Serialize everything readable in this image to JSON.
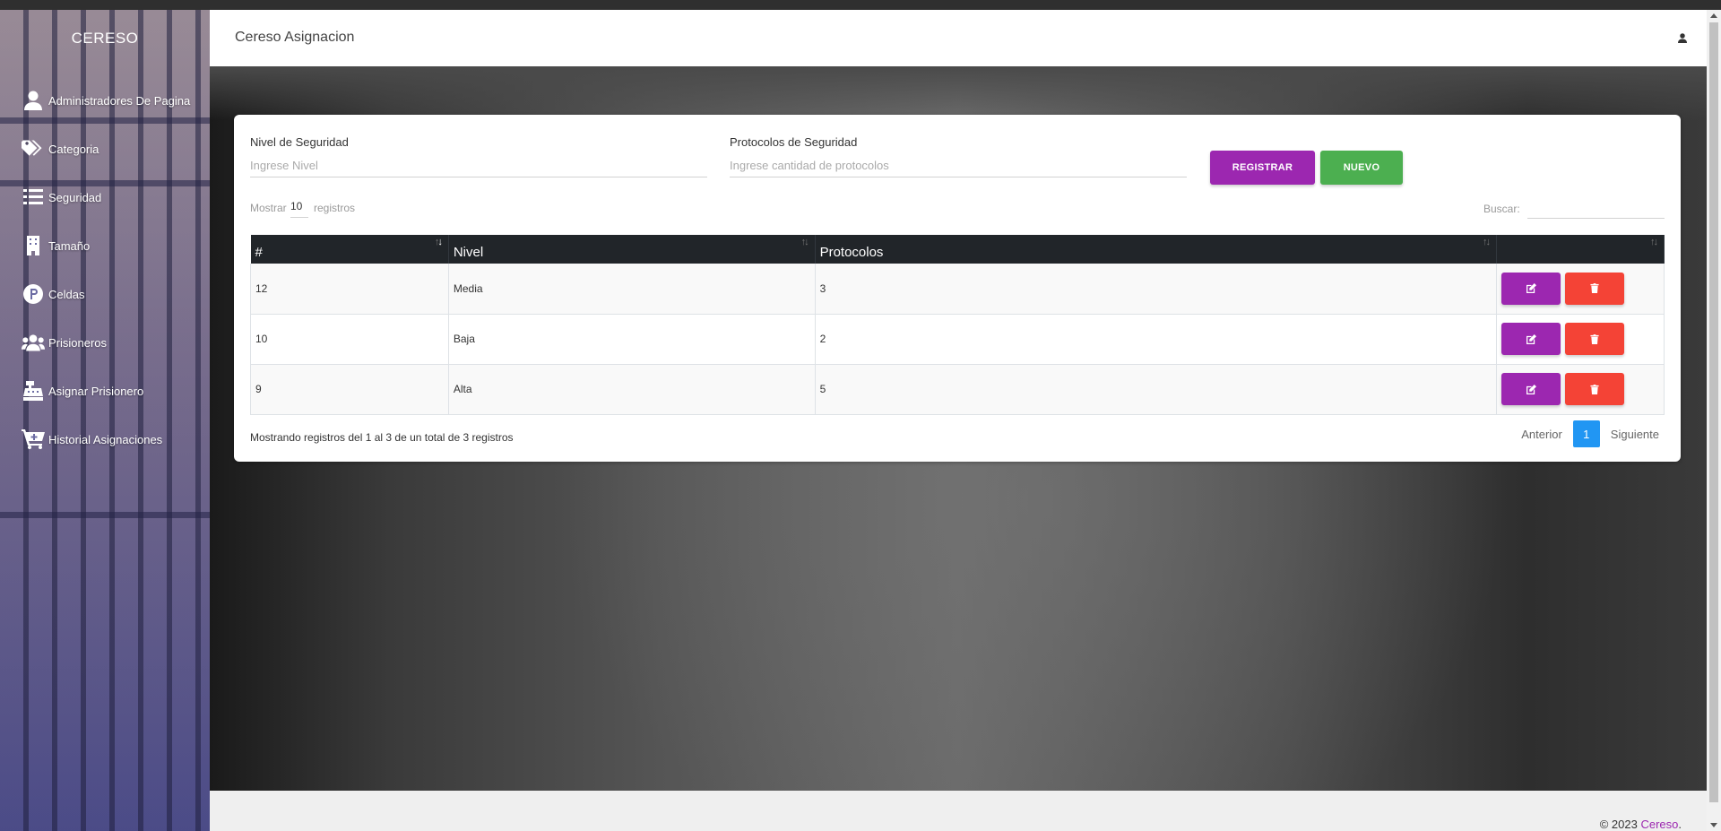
{
  "sidebar": {
    "brand": "CERESO",
    "items": [
      {
        "label": "Administradores De Pagina",
        "icon": "user-icon"
      },
      {
        "label": "Categoria",
        "icon": "tags-icon"
      },
      {
        "label": "Seguridad",
        "icon": "list-icon"
      },
      {
        "label": "Tamaño",
        "icon": "building-icon"
      },
      {
        "label": "Celdas",
        "icon": "parking-icon"
      },
      {
        "label": "Prisioneros",
        "icon": "users-icon"
      },
      {
        "label": "Asignar Prisionero",
        "icon": "cash-register-icon"
      },
      {
        "label": "Historial Asignaciones",
        "icon": "cart-plus-icon"
      }
    ]
  },
  "header": {
    "title": "Cereso Asignacion",
    "user_icon": "user-icon"
  },
  "form": {
    "nivel_label": "Nivel de Seguridad",
    "nivel_placeholder": "Ingrese Nivel",
    "protocolos_label": "Protocolos de Seguridad",
    "protocolos_placeholder": "Ingrese cantidad de protocolos",
    "registrar_label": "REGISTRAR",
    "nuevo_label": "NUEVO"
  },
  "datatable": {
    "show_prefix": "Mostrar",
    "show_value": "10",
    "show_suffix": "registros",
    "search_label": "Buscar:",
    "columns": [
      "#",
      "Nivel",
      "Protocolos",
      ""
    ],
    "rows": [
      {
        "id": "12",
        "nivel": "Media",
        "protocolos": "3"
      },
      {
        "id": "10",
        "nivel": "Baja",
        "protocolos": "2"
      },
      {
        "id": "9",
        "nivel": "Alta",
        "protocolos": "5"
      }
    ],
    "info": "Mostrando registros del 1 al 3 de un total de 3 registros",
    "prev_label": "Anterior",
    "current_page": "1",
    "next_label": "Siguiente"
  },
  "footer": {
    "prefix": "© 2023 ",
    "brand": "Cereso",
    "suffix": "."
  },
  "colors": {
    "purple": "#9c27b0",
    "green": "#4caf50",
    "red": "#f44336",
    "blue": "#2196f3",
    "table_head": "#212529"
  }
}
